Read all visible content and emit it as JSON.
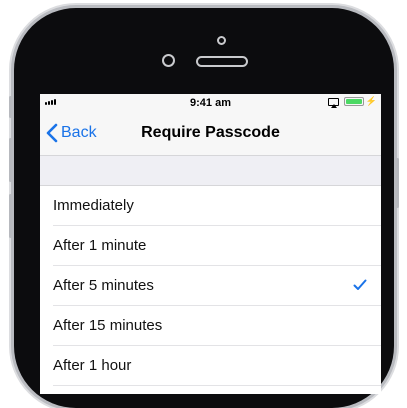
{
  "status_bar": {
    "time": "9:41 am",
    "signal_icon": "signal-bars-icon",
    "airplay_icon": "airplay-icon",
    "battery_icon": "battery-charging-icon",
    "battery_level": 1.0,
    "battery_color": "#4cd964"
  },
  "navbar": {
    "back_label": "Back",
    "title": "Require Passcode",
    "accent_color": "#1a73e8"
  },
  "options": [
    {
      "label": "Immediately",
      "selected": false
    },
    {
      "label": "After 1 minute",
      "selected": false
    },
    {
      "label": "After 5 minutes",
      "selected": true
    },
    {
      "label": "After 15 minutes",
      "selected": false
    },
    {
      "label": "After 1 hour",
      "selected": false
    }
  ]
}
